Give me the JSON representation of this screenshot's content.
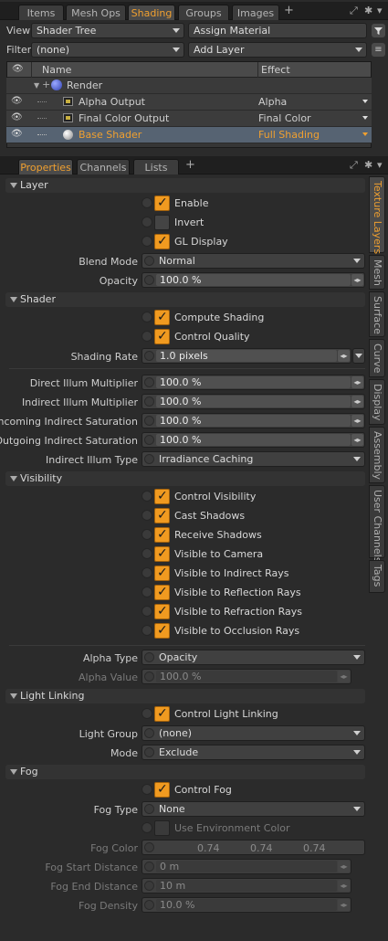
{
  "top_tabs": [
    "Items",
    "Mesh Ops",
    "Shading",
    "Groups",
    "Images"
  ],
  "toolbar": {
    "view_label": "View",
    "view_value": "Shader Tree",
    "assign_material": "Assign Material",
    "filter_label": "Filter",
    "filter_value": "(none)",
    "add_layer": "Add Layer"
  },
  "tree": {
    "col_name": "Name",
    "col_effect": "Effect",
    "rows": [
      {
        "name": "Render",
        "effect": ""
      },
      {
        "name": "Alpha Output",
        "effect": "Alpha"
      },
      {
        "name": "Final Color Output",
        "effect": "Final Color"
      },
      {
        "name": "Base Shader",
        "effect": "Full Shading"
      }
    ]
  },
  "panel_tabs": [
    "Properties",
    "Channels",
    "Lists"
  ],
  "side_tabs": [
    "Texture Layers",
    "Mesh",
    "Surface",
    "Curve",
    "Display",
    "Assembly",
    "User Channels",
    "Tags"
  ],
  "sections": {
    "layer": "Layer",
    "shader": "Shader",
    "visibility": "Visibility",
    "light_linking": "Light Linking",
    "fog": "Fog"
  },
  "layer": {
    "enable": "Enable",
    "invert": "Invert",
    "gl_display": "GL Display",
    "blend_mode_label": "Blend Mode",
    "blend_mode": "Normal",
    "opacity_label": "Opacity",
    "opacity": "100.0 %"
  },
  "shader": {
    "compute_shading": "Compute Shading",
    "control_quality": "Control Quality",
    "shading_rate_label": "Shading Rate",
    "shading_rate": "1.0 pixels",
    "direct_label": "Direct Illum Multiplier",
    "direct": "100.0 %",
    "indirect_label": "Indirect Illum Multiplier",
    "indirect": "100.0 %",
    "incoming_label": "Incoming Indirect Saturation",
    "incoming": "100.0 %",
    "outgoing_label": "Outgoing Indirect Saturation",
    "outgoing": "100.0 %",
    "indirect_type_label": "Indirect Illum Type",
    "indirect_type": "Irradiance Caching"
  },
  "visibility": {
    "items": [
      "Control Visibility",
      "Cast Shadows",
      "Receive Shadows",
      "Visible to Camera",
      "Visible to Indirect Rays",
      "Visible to Reflection Rays",
      "Visible to Refraction Rays",
      "Visible to Occlusion Rays"
    ],
    "alpha_type_label": "Alpha Type",
    "alpha_type": "Opacity",
    "alpha_value_label": "Alpha Value",
    "alpha_value": "100.0 %"
  },
  "light_linking": {
    "control": "Control Light Linking",
    "group_label": "Light Group",
    "group": "(none)",
    "mode_label": "Mode",
    "mode": "Exclude"
  },
  "fog": {
    "control": "Control Fog",
    "type_label": "Fog Type",
    "type": "None",
    "use_env": "Use Environment Color",
    "color_label": "Fog Color",
    "color_r": "0.74",
    "color_g": "0.74",
    "color_b": "0.74",
    "start_label": "Fog Start Distance",
    "start": "0 m",
    "end_label": "Fog End Distance",
    "end": "10 m",
    "density_label": "Fog Density",
    "density": "10.0 %"
  },
  "colors": {
    "accent": "#f0a030",
    "bg": "#2b2b2b"
  }
}
